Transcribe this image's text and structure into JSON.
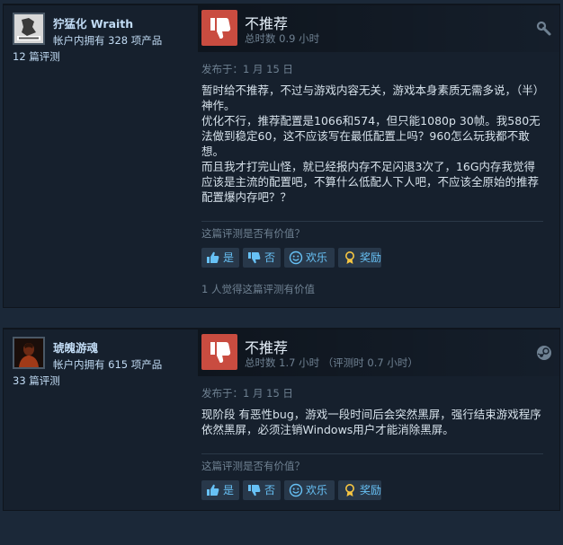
{
  "reviews": [
    {
      "author": {
        "name": "狞猛化 Wraith",
        "products": "帐户内拥有 328 项产品",
        "review_count": "12 篇评测",
        "avatar_icon": "avatar-image"
      },
      "verdict": "不推荐",
      "hours": "总时数 0.9 小时",
      "corner_icon": "wrench-icon",
      "posted": "发布于：1 月 15 日",
      "paragraphs": [
        "暂时给不推荐，不过与游戏内容无关，游戏本身素质无需多说，（半）神作。",
        "优化不行，推荐配置是1066和574，但只能1080p 30帧。我580无法做到稳定60，这不应该写在最低配置上吗？960怎么玩我都不敢想。",
        "而且我才打完山怪，就已经报内存不足闪退3次了，16G内存我觉得应该是主流的配置吧，不算什么低配人下人吧，不应该全原始的推荐配置爆内存吧？？"
      ],
      "helpful_question": "这篇评测是否有价值？",
      "buttons": {
        "yes": "是",
        "no": "否",
        "funny": "欢乐",
        "award": "奖励"
      },
      "found_helpful": "1 人觉得这篇评测有价值"
    },
    {
      "author": {
        "name": "琥魄游魂",
        "products": "帐户内拥有 615 项产品",
        "review_count": "33 篇评测",
        "avatar_icon": "avatar-image"
      },
      "verdict": "不推荐",
      "hours": "总时数 1.7 小时 （评测时 0.7 小时）",
      "corner_icon": "steam-icon",
      "posted": "发布于：1 月 15 日",
      "paragraphs": [
        "现阶段 有恶性bug，游戏一段时间后会突然黑屏，强行结束游戏程序依然黑屏，必须注销Windows用户才能消除黑屏。"
      ],
      "helpful_question": "这篇评测是否有价值？",
      "buttons": {
        "yes": "是",
        "no": "否",
        "funny": "欢乐",
        "award": "奖励"
      }
    }
  ],
  "colors": {
    "background": "#1b2838",
    "card": "#16202d",
    "thumb_down": "#c94c40",
    "link": "#67c1f5",
    "muted": "#6f8192",
    "text": "#d6e1ea"
  }
}
